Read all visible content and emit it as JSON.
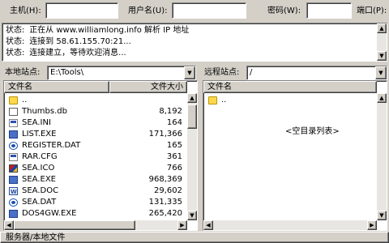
{
  "quick_connect": {
    "host_label": "主机(H):",
    "host_value": "",
    "user_label": "用户名(U):",
    "user_value": "",
    "password_label": "密码(W):",
    "password_value": "",
    "port_label": "端口(P):",
    "port_value": ""
  },
  "log": [
    {
      "key": "状态:",
      "text": "正在从 www.williamlong.info 解析 IP 地址"
    },
    {
      "key": "状态:",
      "text": "连接到 58.61.155.70:21..."
    },
    {
      "key": "状态:",
      "text": "连接建立，等待欢迎消息..."
    }
  ],
  "local": {
    "label": "本地站点:",
    "path": "E:\\Tools\\",
    "col_name": "文件名",
    "col_size": "文件大小",
    "files": [
      {
        "name": "..",
        "size": "",
        "icon": "folder"
      },
      {
        "name": "Thumbs.db",
        "size": "8,192",
        "icon": "file"
      },
      {
        "name": "SEA.INI",
        "size": "164",
        "icon": "sys"
      },
      {
        "name": "LIST.EXE",
        "size": "171,366",
        "icon": "exe"
      },
      {
        "name": "REGISTER.DAT",
        "size": "165",
        "icon": "reg"
      },
      {
        "name": "RAR.CFG",
        "size": "361",
        "icon": "sys"
      },
      {
        "name": "SEA.ICO",
        "size": "766",
        "icon": "img"
      },
      {
        "name": "SEA.EXE",
        "size": "968,369",
        "icon": "exe"
      },
      {
        "name": "SEA.DOC",
        "size": "29,602",
        "icon": "doc"
      },
      {
        "name": "SEA.DAT",
        "size": "131,335",
        "icon": "reg"
      },
      {
        "name": "DOS4GW.EXE",
        "size": "265,420",
        "icon": "exe"
      }
    ]
  },
  "remote": {
    "label": "远程站点:",
    "path": "/",
    "col_name": "文件名",
    "files": [
      {
        "name": "..",
        "icon": "folder"
      }
    ],
    "empty_text": "<空目录列表>"
  },
  "status_bar": {
    "text": "服务器/本地文件"
  }
}
